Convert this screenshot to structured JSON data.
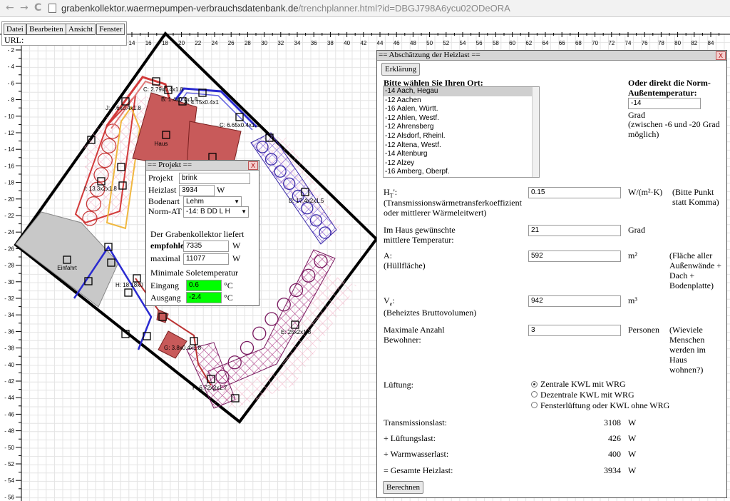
{
  "browser": {
    "back_glyph": "←",
    "forward_glyph": "→",
    "reload_glyph": "C",
    "url_host": "grabenkollektor.waermepumpen-verbrauchsdatenbank.de",
    "url_path": "/trenchplanner.html?id=DBGJ798A6ycu02ODeORA"
  },
  "menu": {
    "items": [
      "Datei",
      "Bearbeiten",
      "Ansicht",
      "Fenster"
    ],
    "url_label": "URL:"
  },
  "ruler": {
    "x_ticks": [
      14,
      16,
      18,
      20,
      22,
      24,
      26,
      28,
      30,
      32,
      34,
      36,
      38,
      40,
      42,
      44,
      46,
      48,
      50,
      52,
      54,
      56,
      58,
      60,
      62,
      64,
      66,
      68,
      70,
      72,
      74,
      76,
      78,
      80,
      82,
      84
    ],
    "y_ticks": [
      2,
      4,
      6,
      8,
      10,
      12,
      14,
      16,
      18,
      20,
      22,
      24,
      26,
      28,
      30,
      32,
      34,
      36,
      38,
      40,
      42,
      44,
      46,
      48,
      50,
      52,
      54,
      56
    ]
  },
  "plan_labels": {
    "haus": "Haus",
    "einfahrt": "Einfahrt",
    "segments": [
      "C: 2.79x0.4x1.8",
      "B: 1.4x0.4x1.8",
      "A: 4.75x0.4x1",
      "C: 6.65x0.4x1.5",
      "J: 7.6x0.4x1.8",
      "I: 13.3x2x1.8",
      "D: 17.4x2x1.5",
      "H: 18.18x0",
      "G: 3.8x0.4x1.8",
      "E: 25x2x1.8",
      "F: 6.72x2x1.7"
    ]
  },
  "project_window": {
    "title": "== Projekt ==",
    "close": "X",
    "projekt_label": "Projekt",
    "projekt_value": "brink",
    "heizlast_label": "Heizlast",
    "heizlast_value": "3934",
    "heizlast_unit": "W",
    "bodenart_label": "Bodenart",
    "bodenart_value": "Lehm",
    "normat_label": "Norm-AT",
    "normat_value": "-14: B DD L H",
    "liefert_text": "Der Grabenkollektor liefert",
    "empfohlen_label": "empfohlen",
    "empfohlen_value": "7335",
    "empfohlen_unit": "W",
    "maximal_label": "maximal",
    "maximal_value": "11077",
    "maximal_unit": "W",
    "sole_heading": "Minimale Soletemperatur",
    "eingang_label": "Eingang",
    "eingang_value": "0.6",
    "eingang_unit": "°C",
    "ausgang_label": "Ausgang",
    "ausgang_value": "-2.4",
    "ausgang_unit": "°C",
    "temp_color": "#00ff00"
  },
  "heizlast_window": {
    "title": "== Abschätzung der Heizlast ==",
    "close": "X",
    "erklaerung_button": "Erklärung",
    "ort_heading": "Bitte wählen Sie Ihren Ort:",
    "orte": [
      "-14 Aach, Hegau",
      "-12 Aachen",
      "-16 Aalen, Württ.",
      "-12 Ahlen, Westf.",
      "-12 Ahrensberg",
      "-12 Alsdorf, Rheinl.",
      "-12 Altena, Westf.",
      "-14 Altenburg",
      "-12 Alzey",
      "-16 Amberg, Oberpf."
    ],
    "norm_heading": "Oder direkt die Norm-Außentemperatur:",
    "norm_value": "-14",
    "norm_unit": "Grad",
    "norm_hint": "(zwischen -6 und -20 Grad möglich)",
    "ht_label": "H",
    "ht_sub": "T",
    "ht_mark": "':",
    "ht_desc": "(Transmissionswärmetransferkoeffizient oder mittlerer Wärmeleitwert)",
    "ht_value": "0.15",
    "ht_unit": "W/(m²·K)",
    "ht_hint": "(Bitte Punkt statt Komma)",
    "temp_label": "Im Haus gewünschte mittlere Temperatur:",
    "temp_value": "21",
    "temp_unit": "Grad",
    "a_label": "A:",
    "a_desc": "(Hüllfläche)",
    "a_value": "592",
    "a_unit": "m²",
    "a_hint": "(Fläche aller Außenwände + Dach + Bodenplatte)",
    "ve_label": "V",
    "ve_sub": "e",
    "ve_mark": ":",
    "ve_desc": "(Beheiztes Bruttovolumen)",
    "ve_value": "942",
    "ve_unit": "m³",
    "bew_label": "Maximale Anzahl Bewohner:",
    "bew_value": "3",
    "bew_unit": "Personen",
    "bew_hint": "(Wieviele Menschen werden im Haus wohnen?)",
    "lueftung_label": "Lüftung:",
    "lueftung_options": [
      "Zentrale KWL mit WRG",
      "Dezentrale KWL mit WRG",
      "Fensterlüftung oder KWL ohne WRG"
    ],
    "trans_label": "Transmissionslast:",
    "trans_value": "3108",
    "lueft_label": "+ Lüftungslast:",
    "lueft_value": "426",
    "ww_label": "+ Warmwasserlast:",
    "ww_value": "400",
    "gesamt_label": "= Gesamte Heizlast:",
    "gesamt_value": "3934",
    "unit_w": "W",
    "berechnen_button": "Berechnen"
  }
}
